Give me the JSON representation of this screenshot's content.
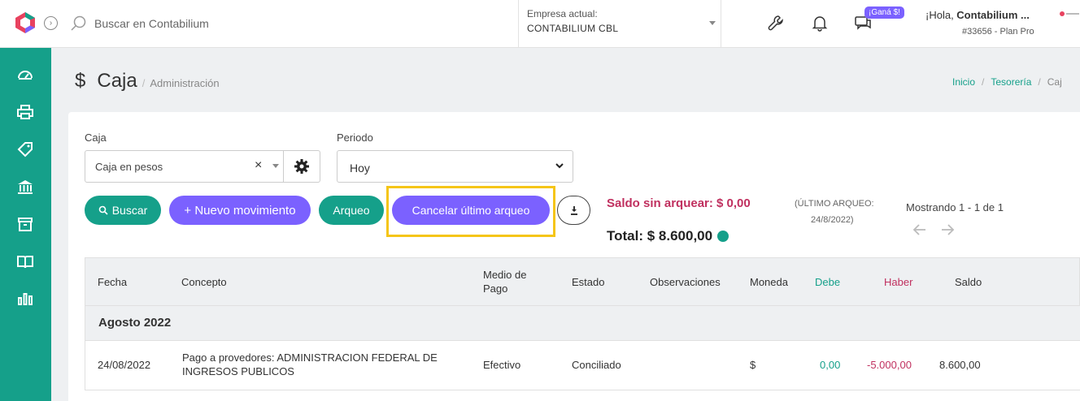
{
  "header": {
    "search_placeholder": "Buscar en Contabilium",
    "company_label": "Empresa actual:",
    "company_value": "CONTABILIUM CBL",
    "promo_badge": "¡Ganá $!",
    "greeting": "¡Hola, ",
    "user_name": "Contabilium ...",
    "plan": "#33656 - Plan Pro",
    "icons": [
      "wrench-icon",
      "bell-icon",
      "chat-icon"
    ]
  },
  "sidebar": {
    "items": [
      "dashboard-icon",
      "printer-icon",
      "tag-icon",
      "bank-icon",
      "archive-icon",
      "book-icon",
      "chart-icon"
    ],
    "accent": "#15a08a"
  },
  "page": {
    "icon": "$",
    "title": "Caja",
    "subtitle": "Administración",
    "breadcrumb": [
      "Inicio",
      "Tesorería",
      "Caj"
    ]
  },
  "filters": {
    "caja_label": "Caja",
    "caja_value": "Caja en pesos",
    "periodo_label": "Periodo",
    "periodo_value": "Hoy"
  },
  "actions": {
    "buscar": "Buscar",
    "nuevo": "+ Nuevo movimiento",
    "arqueo": "Arqueo",
    "cancelar": "Cancelar último arqueo"
  },
  "summary": {
    "saldo": "Saldo sin arquear: $ 0,00",
    "total": "Total: $ 8.600,00",
    "ultimo_label": "(ÚLTIMO ARQUEO:",
    "ultimo_value": "24/8/2022)",
    "mostrando": "Mostrando 1 - 1 de 1"
  },
  "table": {
    "headers": [
      "Fecha",
      "Concepto",
      "Medio de Pago",
      "Estado",
      "Observaciones",
      "Moneda",
      "Debe",
      "Haber",
      "Saldo"
    ],
    "group": "Agosto 2022",
    "rows": [
      {
        "fecha": "24/08/2022",
        "concepto": "Pago a provedores: ADMINISTRACION FEDERAL DE INGRESOS PUBLICOS",
        "medio": "Efectivo",
        "estado": "Conciliado",
        "observaciones": "",
        "moneda": "$",
        "debe": "0,00",
        "haber": "-5.000,00",
        "saldo": "8.600,00"
      }
    ]
  },
  "colors": {
    "green": "#15a08a",
    "purple": "#7b61ff",
    "magenta": "#c0305f",
    "highlight": "#f5c518"
  }
}
